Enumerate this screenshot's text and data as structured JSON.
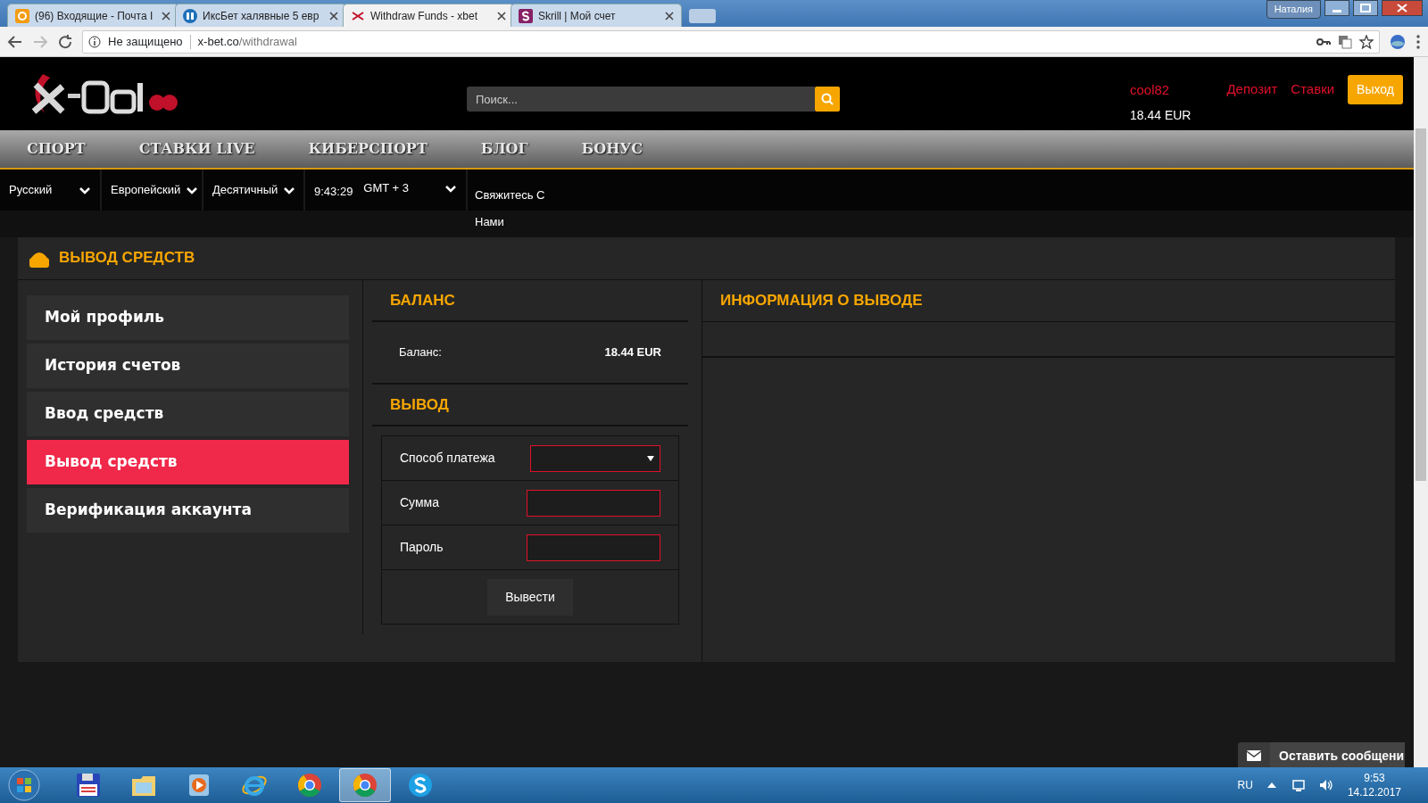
{
  "browser": {
    "tabs": [
      {
        "kind": "mail",
        "title": "(96) Входящие - Почта I",
        "selected": false
      },
      {
        "kind": "kf",
        "title": "ИксБет халявные 5 евр",
        "selected": false
      },
      {
        "kind": "xbet",
        "title": "Withdraw Funds - xbet",
        "selected": true
      },
      {
        "kind": "skrill",
        "title": "Skrill | Мой счет",
        "selected": false
      }
    ],
    "user": "Наталия",
    "security": "Не защищено",
    "url_host": "x-bet.co",
    "url_path": "/withdrawal"
  },
  "header": {
    "search": {
      "placeholder": "Поиск..."
    },
    "username": "cool82",
    "balance": "18.44 EUR",
    "links": [
      "Депозит",
      "Ставки"
    ],
    "logout": "Выход"
  },
  "nav": [
    "СПОРТ",
    "СТАВКИ LIVE",
    "КИБЕРСПОРТ",
    "БЛОГ",
    "БОНУС"
  ],
  "settings": {
    "language": "Русский",
    "odds_region": "Европейский",
    "odds_format": "Десятичный",
    "time": "9:43:29",
    "timezone": "GMT + 3",
    "contact": "Свяжитесь С Нами"
  },
  "page_title": "ВЫВОД СРЕДСТВ",
  "sidebar": [
    {
      "label": "Мой профиль",
      "selected": false
    },
    {
      "label": "История счетов",
      "selected": false
    },
    {
      "label": "Ввод средств",
      "selected": false
    },
    {
      "label": "Вывод средств",
      "selected": true
    },
    {
      "label": "Верификация аккаунта",
      "selected": false
    }
  ],
  "balance": {
    "heading": "БАЛАНС",
    "label": "Баланс:",
    "value": "18.44 EUR"
  },
  "withdraw": {
    "heading": "ВЫВОД",
    "fields": [
      {
        "kind": "select",
        "label": "Способ платежа"
      },
      {
        "kind": "text",
        "label": "Сумма"
      },
      {
        "kind": "password",
        "label": "Пароль"
      }
    ],
    "submit": "Вывести"
  },
  "info": {
    "heading": "ИНФОРМАЦИЯ О ВЫВОДЕ"
  },
  "chat": {
    "label": "Оставить сообщени"
  },
  "taskbar": {
    "items": [
      {
        "kind": "floppy",
        "selected": false
      },
      {
        "kind": "folder",
        "selected": false
      },
      {
        "kind": "player",
        "selected": false
      },
      {
        "kind": "ie",
        "selected": false
      },
      {
        "kind": "chrome",
        "selected": false
      },
      {
        "kind": "chrome",
        "selected": true
      },
      {
        "kind": "skype",
        "selected": false
      }
    ],
    "language": "RU",
    "time": "9:53",
    "date": "14.12.2017"
  }
}
